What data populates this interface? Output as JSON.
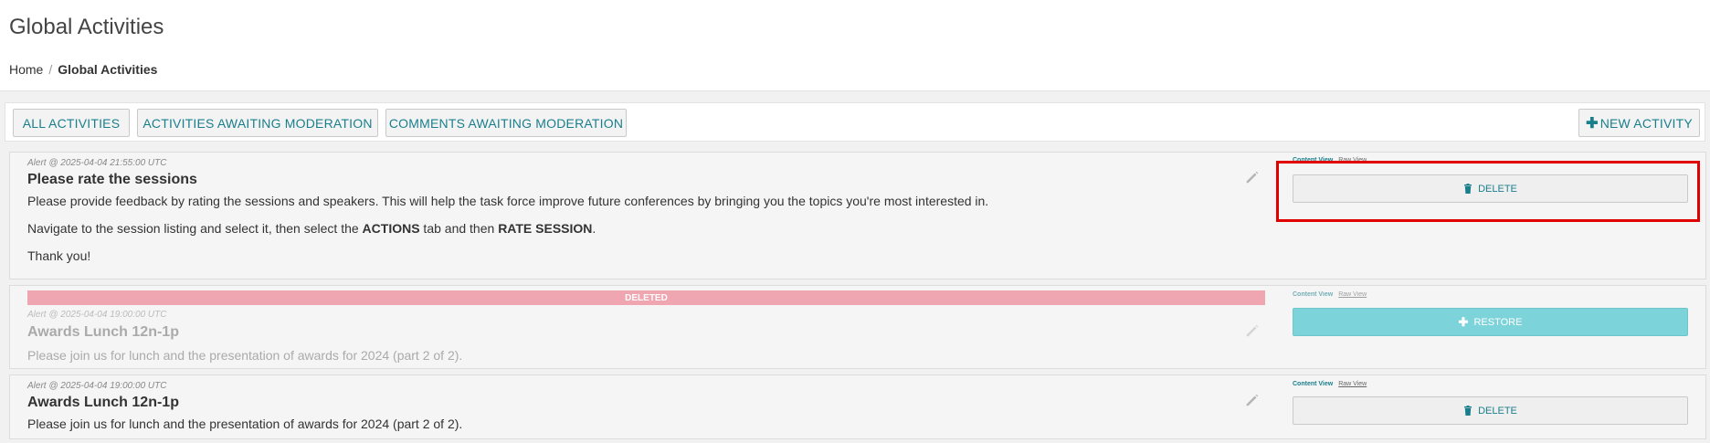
{
  "header": {
    "title": "Global Activities",
    "breadcrumb": {
      "home": "Home",
      "separator": "/",
      "current": "Global Activities"
    }
  },
  "toolbar": {
    "all_activities": "ALL ACTIVITIES",
    "activities_moderation": "ACTIVITIES AWAITING MODERATION",
    "comments_moderation": "COMMENTS AWAITING MODERATION",
    "new_activity": "NEW ACTIVITY"
  },
  "cards": [
    {
      "meta": "Alert @ 2025-04-04 21:55:00 UTC",
      "title": "Please rate the sessions",
      "para1": "Please provide feedback by rating the sessions and speakers.  This will help the task force improve future conferences by bringing you the topics you're most interested in.",
      "para2_pre": "Navigate to the session listing and select it, then select the ",
      "para2_b1": "ACTIONS",
      "para2_mid": " tab and then ",
      "para2_b2": "RATE SESSION",
      "para2_post": ".",
      "para3": "Thank you!",
      "content_view": "Content View",
      "raw_view": "Raw View",
      "action": "DELETE"
    },
    {
      "status": "DELETED",
      "meta": "Alert @ 2025-04-04 19:00:00 UTC",
      "title": "Awards Lunch 12n-1p",
      "para1": "Please join us for lunch and the presentation of awards for 2024 (part 2 of 2).",
      "content_view": "Content View",
      "raw_view": "Raw View",
      "action": "RESTORE"
    },
    {
      "meta": "Alert @ 2025-04-04 19:00:00 UTC",
      "title": "Awards Lunch 12n-1p",
      "para1": "Please join us for lunch and the presentation of awards for 2024 (part 2 of 2).",
      "content_view": "Content View",
      "raw_view": "Raw View",
      "action": "DELETE"
    }
  ],
  "colors": {
    "accent": "#1a7f8c",
    "deleted_bar": "#f0a6b0",
    "restore_button": "#7dd3da",
    "highlight": "#e00000"
  },
  "icons": {
    "delete": "trash-icon",
    "restore": "plus-icon",
    "edit": "pencil-icon",
    "new": "plus-icon"
  }
}
